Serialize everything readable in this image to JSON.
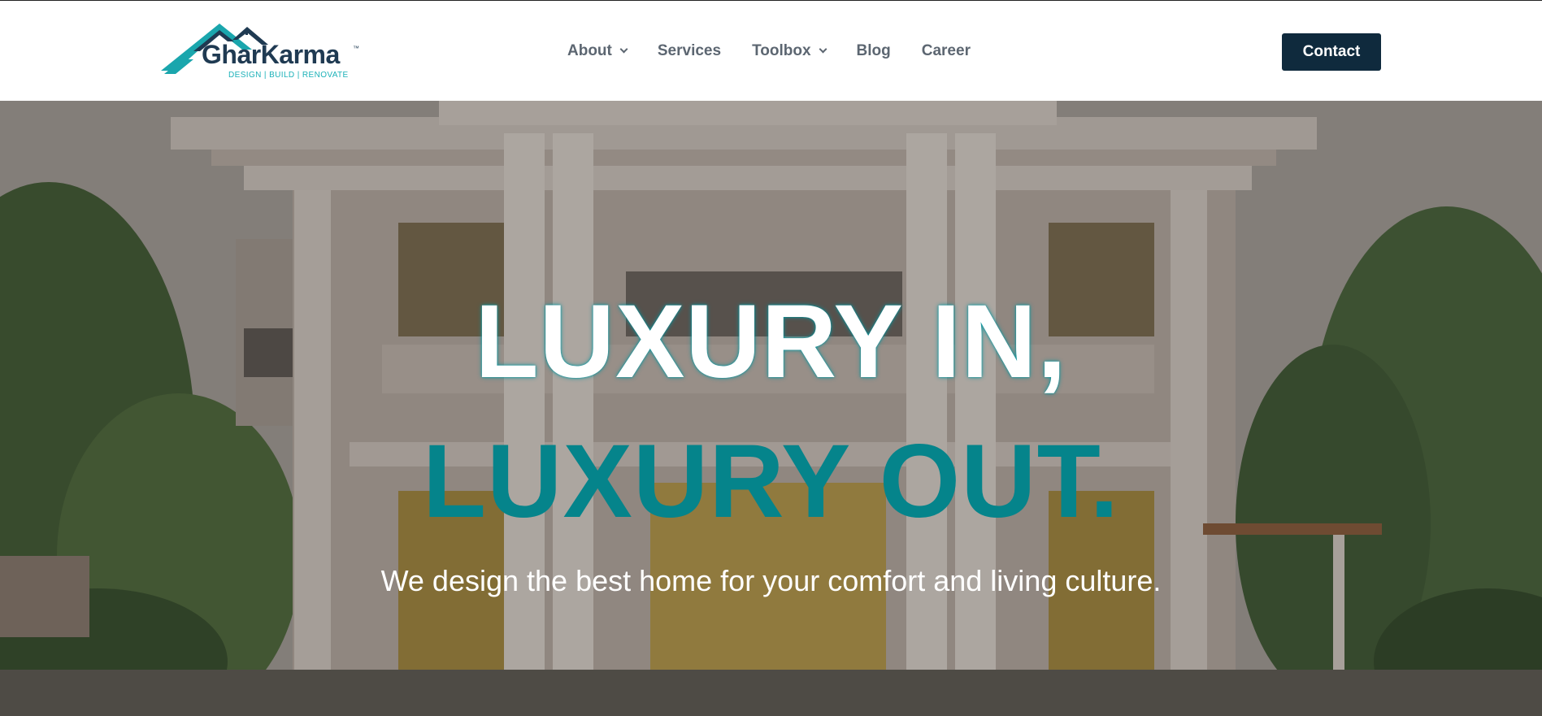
{
  "header": {
    "logo": {
      "name": "GharKarma",
      "trademark": "™",
      "tagline": "DESIGN | BUILD | RENOVATE"
    },
    "nav": [
      {
        "label": "About",
        "has_dropdown": true
      },
      {
        "label": "Services",
        "has_dropdown": false
      },
      {
        "label": "Toolbox",
        "has_dropdown": true
      },
      {
        "label": "Blog",
        "has_dropdown": false
      },
      {
        "label": "Career",
        "has_dropdown": false
      }
    ],
    "contact_label": "Contact"
  },
  "hero": {
    "line1": "LUXURY IN,",
    "line2": "LUXURY OUT.",
    "subtitle": "We design the best home for your comfort and living culture."
  },
  "colors": {
    "brand_dark": "#0f2a3d",
    "brand_teal": "#05848b",
    "nav_text": "#5c6671"
  },
  "icons": [
    "house-roof-logo-icon",
    "chevron-down-icon"
  ]
}
